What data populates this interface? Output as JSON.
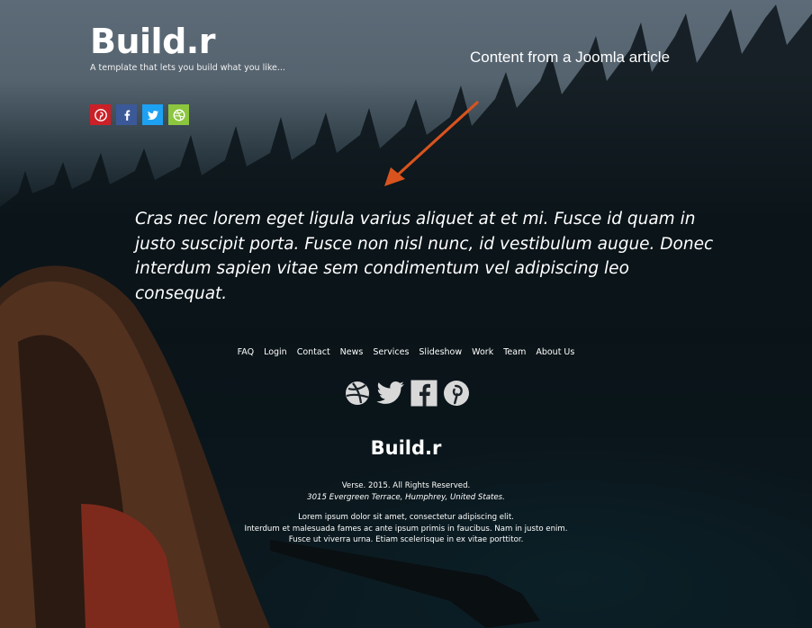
{
  "header": {
    "brand": "Build.r",
    "tagline": "A template that lets you build what you like..."
  },
  "social_top": [
    {
      "icon": "pinterest-icon",
      "color": "#cb2027"
    },
    {
      "icon": "facebook-icon",
      "color": "#3b5998"
    },
    {
      "icon": "twitter-icon",
      "color": "#1da1f2"
    },
    {
      "icon": "dribbble-icon",
      "color": "#8cc63f"
    }
  ],
  "annotation": {
    "text": "Content from a Joomla article",
    "arrow_color": "#d9531e"
  },
  "article": {
    "text": "Cras nec lorem eget ligula varius aliquet at et mi. Fusce id quam in justo suscipit porta. Fusce non nisl nunc, id vestibulum augue. Donec interdum sapien vitae sem condimentum vel adipiscing leo consequat."
  },
  "footer_menu": [
    "FAQ",
    "Login",
    "Contact",
    "News",
    "Services",
    "Slideshow",
    "Work",
    "Team",
    "About Us"
  ],
  "social_footer": [
    "dribbble-icon",
    "twitter-icon",
    "facebook-icon",
    "pinterest-icon"
  ],
  "footer": {
    "brand": "Build.r",
    "copyright": "Verse. 2015. All Rights Reserved.",
    "address": "3015 Evergreen Terrace, Humphrey, United States.",
    "line1": "Lorem ipsum dolor sit amet, consectetur adipiscing elit.",
    "line2": "Interdum et malesuada fames ac ante ipsum primis in faucibus. Nam in justo enim.",
    "line3": "Fusce ut viverra urna. Etiam scelerisque in ex vitae porttitor."
  }
}
